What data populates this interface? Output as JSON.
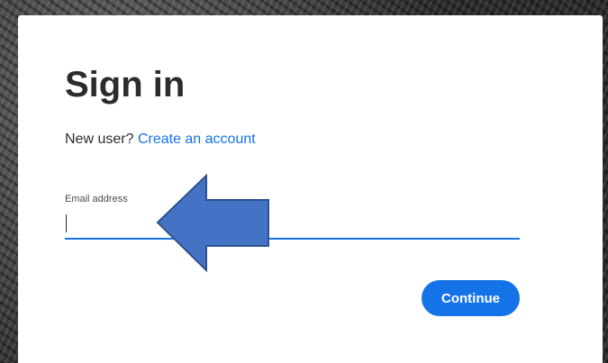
{
  "signin": {
    "title": "Sign in",
    "new_user_prompt": "New user?",
    "create_account_link": "Create an account",
    "email_label": "Email address",
    "email_value": "",
    "continue_label": "Continue"
  },
  "colors": {
    "accent": "#1473e6",
    "text": "#2c2c2c",
    "annotation_arrow_fill": "#4472c4",
    "annotation_arrow_stroke": "#2f528f"
  },
  "annotation": {
    "icon": "left-arrow-icon"
  }
}
